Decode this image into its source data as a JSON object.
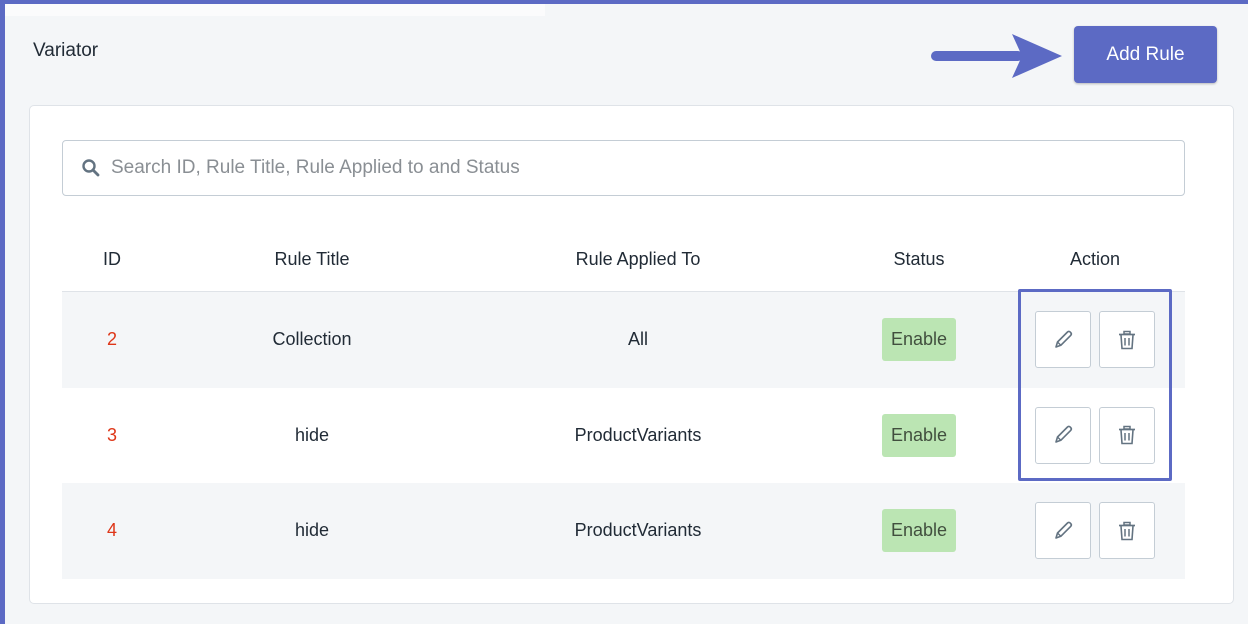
{
  "header": {
    "title": "Variator",
    "add_rule_label": "Add Rule"
  },
  "colors": {
    "accent": "#5c6ac4",
    "status_enabled_bg": "#bbe5b3",
    "id_text": "#de3618"
  },
  "search": {
    "placeholder": "Search ID, Rule Title, Rule Applied to and Status",
    "value": "",
    "icon": "search-icon"
  },
  "table": {
    "columns": [
      "ID",
      "Rule Title",
      "Rule Applied To",
      "Status",
      "Action"
    ],
    "rows": [
      {
        "id": "2",
        "title": "Collection",
        "applied_to": "All",
        "status": "Enable"
      },
      {
        "id": "3",
        "title": "hide",
        "applied_to": "ProductVariants",
        "status": "Enable"
      },
      {
        "id": "4",
        "title": "hide",
        "applied_to": "ProductVariants",
        "status": "Enable"
      }
    ],
    "action_icons": [
      "pencil-icon",
      "trash-icon"
    ]
  }
}
